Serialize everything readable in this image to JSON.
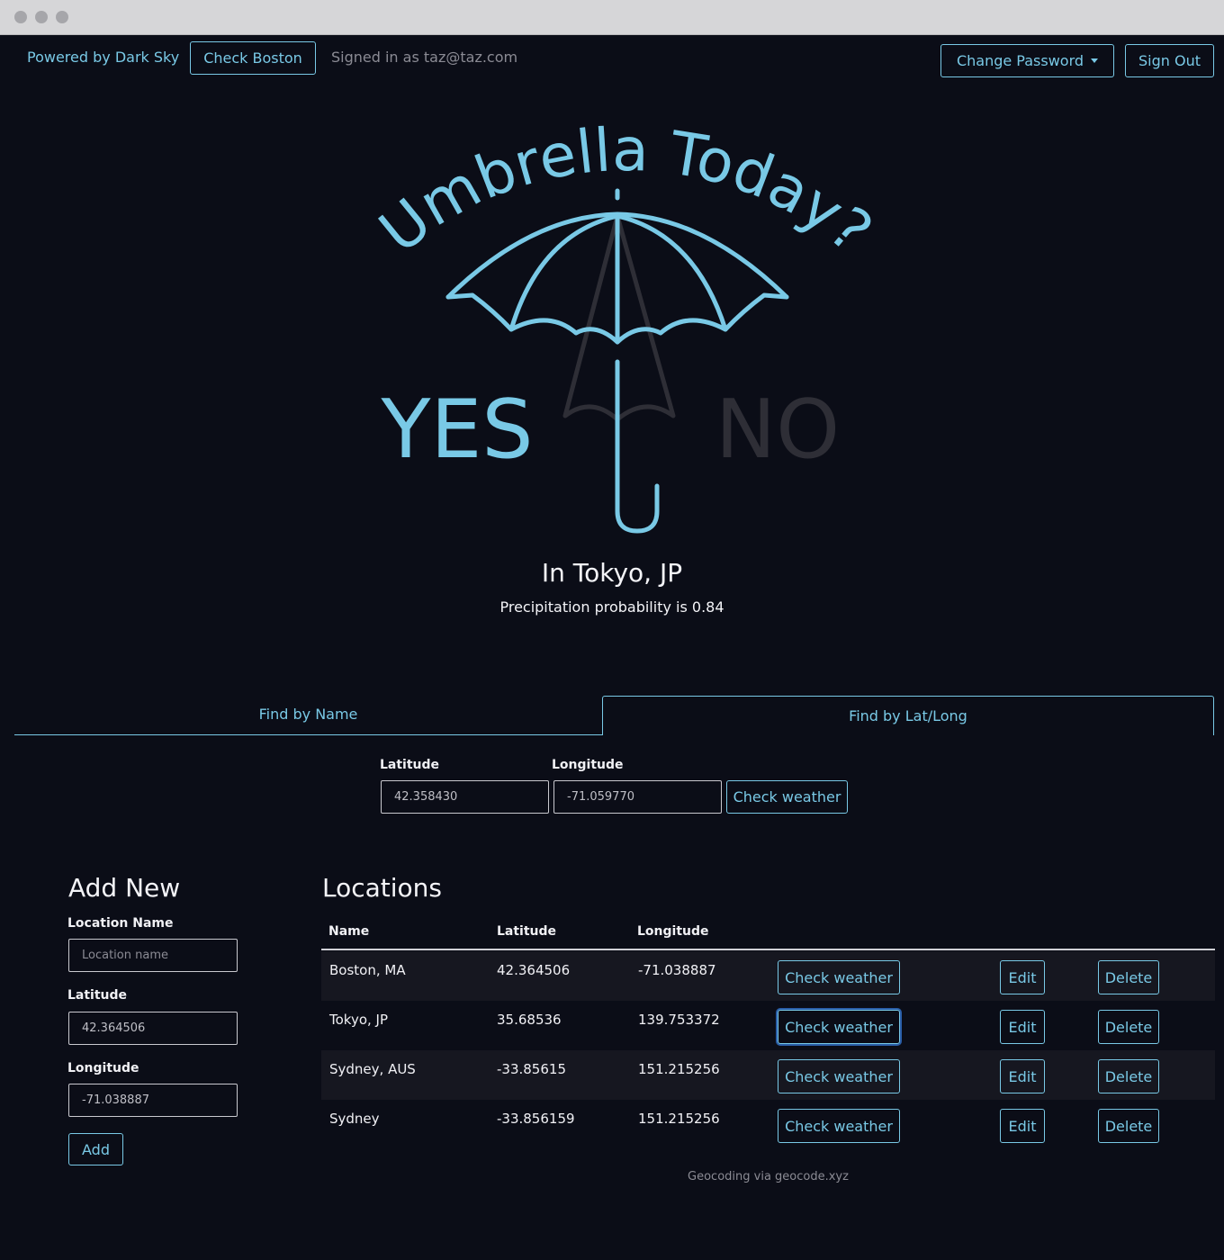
{
  "nav": {
    "powered_by": "Powered by Dark Sky",
    "check_boston": "Check Boston",
    "signed_in": "Signed in as taz@taz.com",
    "change_password": "Change Password",
    "sign_out": "Sign Out"
  },
  "hero": {
    "title": "Umbrella Today?",
    "yes": "YES",
    "no": "NO",
    "location": "In Tokyo, JP",
    "probability": "Precipitation probability is 0.84"
  },
  "tabs": [
    {
      "label": "Find by Name"
    },
    {
      "label": "Find by Lat/Long"
    }
  ],
  "latlong_form": {
    "latitude_label": "Latitude",
    "latitude_value": "42.358430",
    "longitude_label": "Longitude",
    "longitude_value": "-71.059770",
    "check_label": "Check weather"
  },
  "add_new": {
    "title": "Add New",
    "name_label": "Location Name",
    "name_placeholder": "Location name",
    "lat_label": "Latitude",
    "lat_value": "42.364506",
    "long_label": "Longitude",
    "long_value": "-71.038887",
    "add_label": "Add"
  },
  "locations": {
    "title": "Locations",
    "headers": [
      "Name",
      "Latitude",
      "Longitude"
    ],
    "rows": [
      {
        "name": "Boston, MA",
        "lat": "42.364506",
        "long": "-71.038887"
      },
      {
        "name": "Tokyo, JP",
        "lat": "35.68536",
        "long": "139.753372"
      },
      {
        "name": "Sydney, AUS",
        "lat": "-33.85615",
        "long": "151.215256"
      },
      {
        "name": "Sydney",
        "lat": "-33.856159",
        "long": "151.215256"
      }
    ],
    "check_label": "Check weather",
    "edit_label": "Edit",
    "delete_label": "Delete"
  },
  "footer": "Geocoding via geocode.xyz",
  "colors": {
    "accent": "#79c9e6",
    "background": "#0b0d17",
    "muted": "#2e2e36"
  }
}
